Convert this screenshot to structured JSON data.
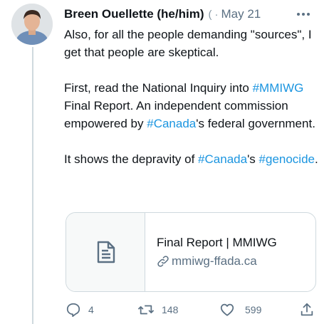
{
  "tweet": {
    "author_name": "Breen Ouellette (he/him)",
    "handle_truncated": "(",
    "separator": "·",
    "date": "May 21",
    "more_icon": "more-icon",
    "paragraphs": [
      [
        {
          "t": "Also, for all the people demanding \"sources\", I get that people are skeptical."
        }
      ],
      [
        {
          "t": "First, read the National Inquiry into "
        },
        {
          "t": "#MMIWG",
          "tag": true
        },
        {
          "t": " Final Report. An independent commission empowered by "
        },
        {
          "t": "#Canada",
          "tag": true
        },
        {
          "t": "'s federal government."
        }
      ],
      [
        {
          "t": "It shows the depravity of "
        },
        {
          "t": "#Canada",
          "tag": true
        },
        {
          "t": "'s "
        },
        {
          "t": "#genocide",
          "tag": true
        },
        {
          "t": "."
        }
      ]
    ]
  },
  "card": {
    "title": "Final Report | MMIWG",
    "domain": "mmiwg-ffada.ca",
    "thumb_icon": "document-icon",
    "link_icon": "link-icon"
  },
  "actions": {
    "reply_count": "4",
    "retweet_count": "148",
    "like_count": "599"
  },
  "colors": {
    "hashtag": "#1b95e0",
    "muted": "#5b7083",
    "border": "#cfd9de"
  }
}
